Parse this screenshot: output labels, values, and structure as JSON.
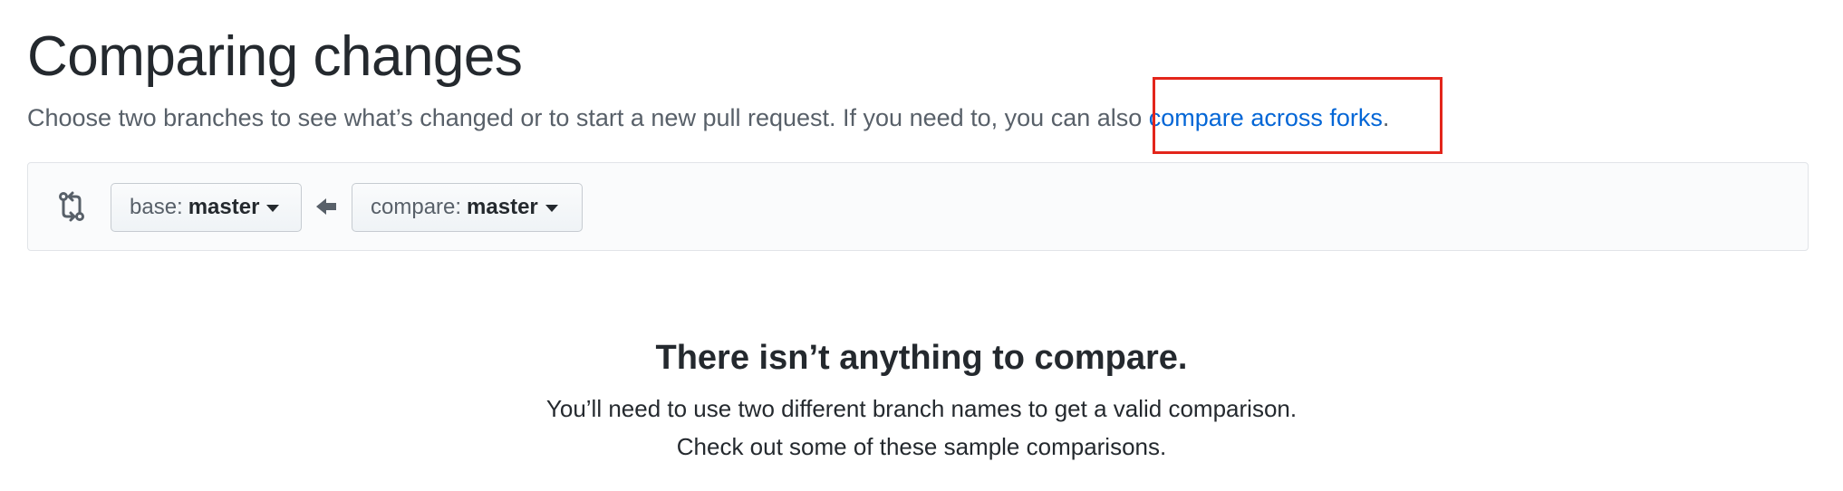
{
  "header": {
    "title": "Comparing changes",
    "subtitle_prefix": "Choose two branches to see what’s changed or to start a new pull request. If you need to, you can also ",
    "subtitle_link": "compare across forks",
    "subtitle_suffix": "."
  },
  "range_editor": {
    "icons": {
      "compare": "git-compare-icon",
      "direction": "arrow-left-icon"
    },
    "base": {
      "prefix": "base:",
      "branch": "master"
    },
    "compare": {
      "prefix": "compare:",
      "branch": "master"
    }
  },
  "blankslate": {
    "title": "There isn’t anything to compare.",
    "line1": "You’ll need to use two different branch names to get a valid comparison.",
    "line2": "Check out some of these sample comparisons."
  },
  "colors": {
    "link": "#0366d6",
    "highlight": "#e3251b",
    "text": "#24292e",
    "muted": "#586069"
  }
}
